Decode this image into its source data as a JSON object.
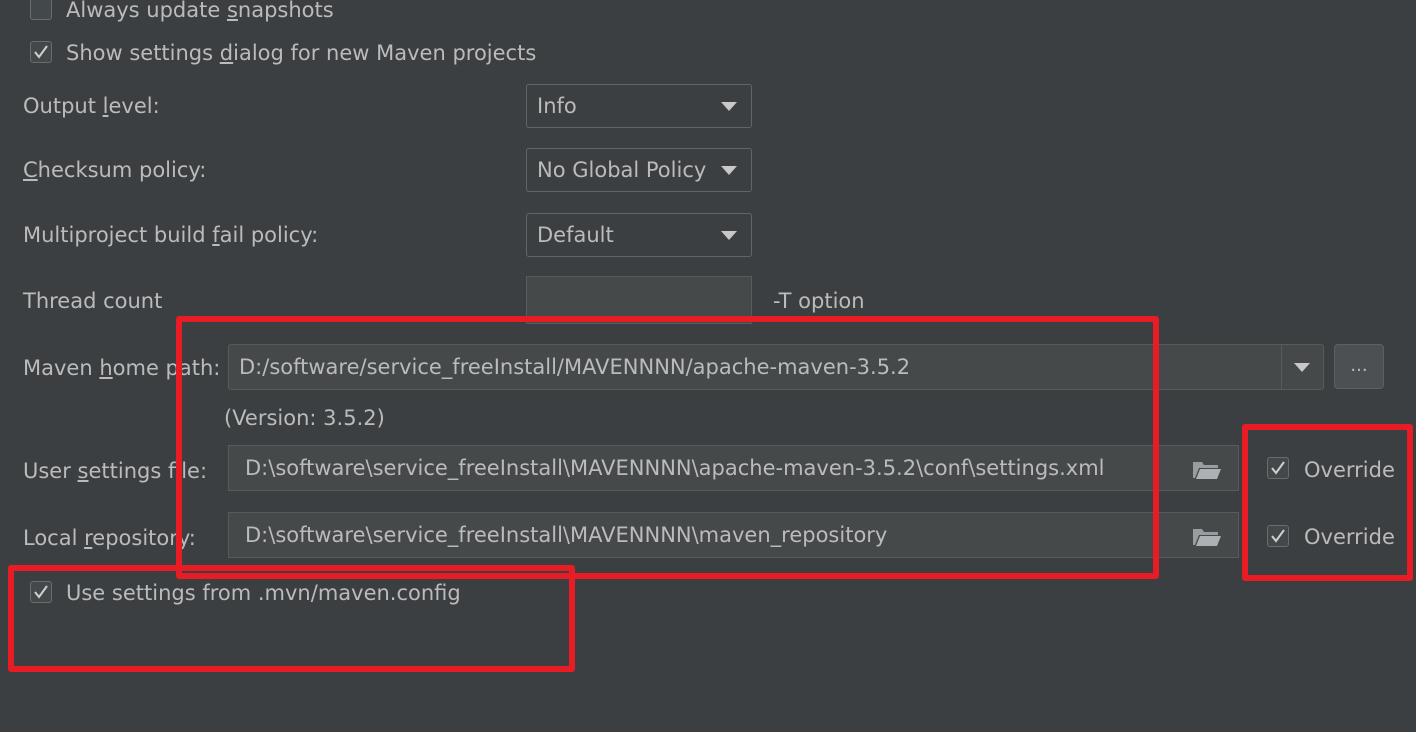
{
  "checkboxes": {
    "always_update": {
      "label_pre": "Always update ",
      "label_mn": "s",
      "label_post": "napshots",
      "checked": false
    },
    "show_settings": {
      "label_pre": "Show settings ",
      "label_mn": "d",
      "label_post": "ialog for new Maven projects",
      "checked": true
    },
    "use_mvn_config": {
      "label": "Use settings from .mvn/maven.config",
      "checked": true
    }
  },
  "output_level": {
    "label_pre": "Output ",
    "label_mn": "l",
    "label_post": "evel:",
    "value": "Info"
  },
  "checksum_policy": {
    "label_pre": "",
    "label_mn": "C",
    "label_post": "hecksum policy:",
    "value": "No Global Policy"
  },
  "multiproject_fail": {
    "label_pre": "Multiproject build ",
    "label_mn": "f",
    "label_post": "ail policy:",
    "value": "Default"
  },
  "thread_count": {
    "label": "Thread count",
    "value": "",
    "suffix": "-T option"
  },
  "maven_home": {
    "label_pre": "Maven ",
    "label_mn": "h",
    "label_post": "ome path:",
    "value": "D:/software/service_freeInstall/MAVENNNN/apache-maven-3.5.2",
    "version": "(Version: 3.5.2)",
    "browse_label": "..."
  },
  "user_settings": {
    "label_pre": "User ",
    "label_mn": "s",
    "label_post": "ettings file:",
    "value": "D:\\software\\service_freeInstall\\MAVENNNN\\apache-maven-3.5.2\\conf\\settings.xml",
    "override_label": "Override",
    "override_checked": true
  },
  "local_repository": {
    "label_pre": "Local ",
    "label_mn": "r",
    "label_post": "epository:",
    "value": "D:\\software\\service_freeInstall\\MAVENNNN\\maven_repository",
    "override_label": "Override",
    "override_checked": true
  },
  "colors": {
    "background": "#3c3f41",
    "text": "#bbbbbb",
    "field_background": "#45494a",
    "highlight_red": "#e81c24"
  }
}
